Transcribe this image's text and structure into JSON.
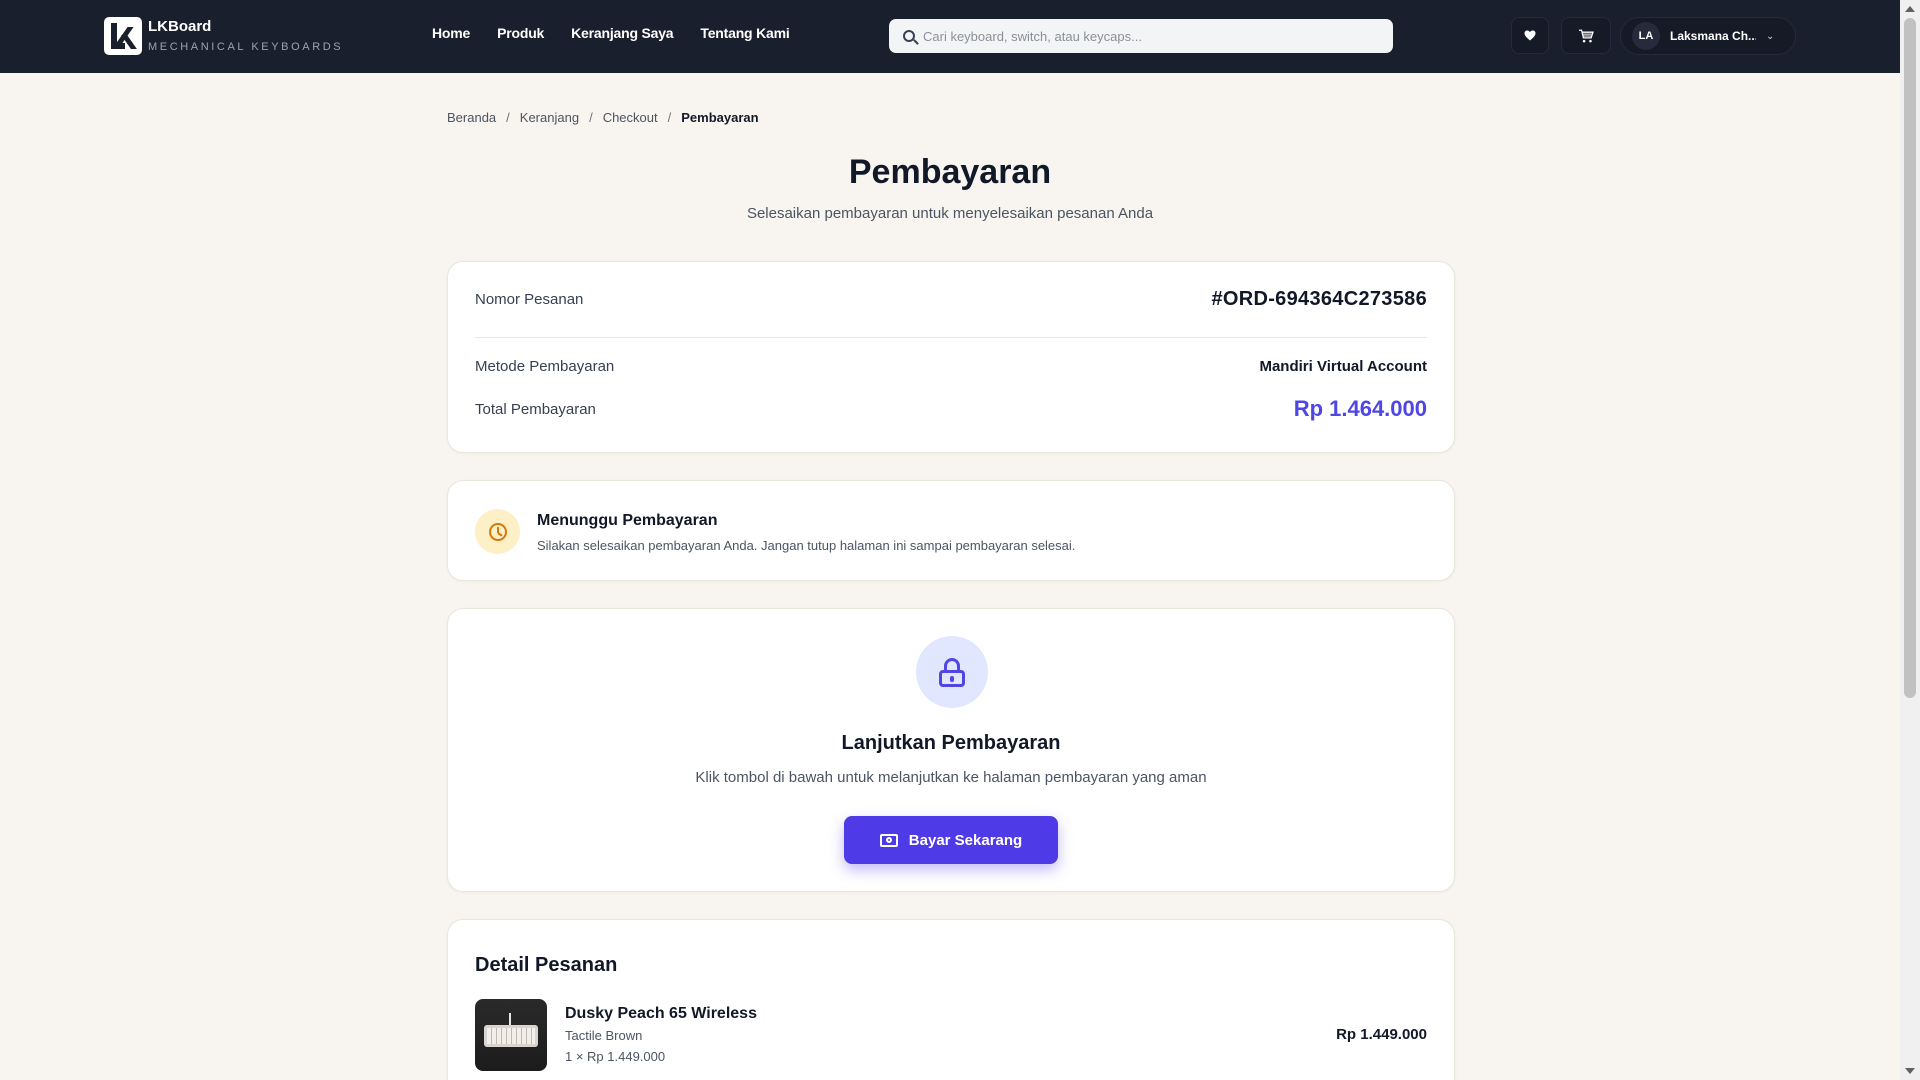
{
  "header": {
    "brand_name": "LKBoard",
    "brand_tagline": "MECHANICAL KEYBOARDS",
    "nav": [
      {
        "label": "Home"
      },
      {
        "label": "Produk"
      },
      {
        "label": "Keranjang Saya"
      },
      {
        "label": "Tentang Kami"
      }
    ],
    "search_placeholder": "Cari keyboard, switch, atau keycaps...",
    "wishlist_icon": "heart-icon",
    "cart_icon": "cart-icon",
    "user": {
      "initials": "LA",
      "name": "Laksmana Ch..."
    }
  },
  "breadcrumb": [
    {
      "label": "Beranda"
    },
    {
      "label": "Keranjang"
    },
    {
      "label": "Checkout"
    },
    {
      "label": "Pembayaran"
    }
  ],
  "breadcrumb_separator": "/",
  "page": {
    "title": "Pembayaran",
    "subtitle": "Selesaikan pembayaran untuk menyelesaikan pesanan Anda"
  },
  "summary": {
    "order_label": "Nomor Pesanan",
    "order_number": "#ORD-694364C273586",
    "method_label": "Metode Pembayaran",
    "method_value": "Mandiri Virtual Account",
    "total_label": "Total Pembayaran",
    "total_value": "Rp 1.464.000"
  },
  "status": {
    "title": "Menunggu Pembayaran",
    "description": "Silakan selesaikan pembayaran Anda. Jangan tutup halaman ini sampai pembayaran selesai.",
    "icon": "clock-icon"
  },
  "payment": {
    "icon": "lock-icon",
    "title": "Lanjutkan Pembayaran",
    "description": "Klik tombol di bawah untuk melanjutkan ke halaman pembayaran yang aman",
    "button_label": "Bayar Sekarang",
    "button_icon": "cash-icon"
  },
  "detail": {
    "title": "Detail Pesanan",
    "items": [
      {
        "name": "Dusky Peach 65 Wireless",
        "variant": "Tactile Brown",
        "qty_line": "1 × Rp 1.449.000",
        "price": "Rp 1.449.000"
      }
    ]
  },
  "colors": {
    "header_bg": "#1a1f2e",
    "page_bg": "#f8f4ef",
    "accent": "#4f46e5",
    "pending": "#d97706"
  }
}
